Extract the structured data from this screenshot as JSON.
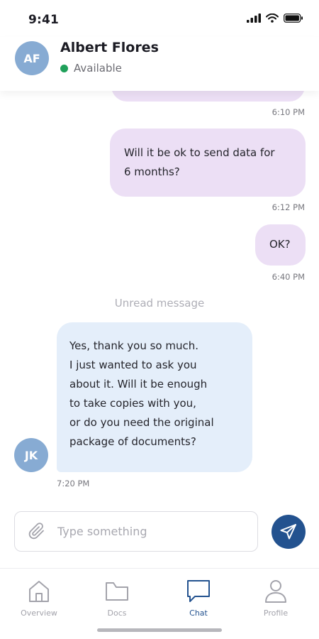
{
  "status_bar": {
    "time": "9:41"
  },
  "header": {
    "avatar_initials": "AF",
    "contact_name": "Albert Flores",
    "presence": "Available"
  },
  "messages": [
    {
      "direction": "out",
      "lines": [],
      "time": "6:10 PM"
    },
    {
      "direction": "out",
      "lines": [
        "Will it be ok to send data for",
        "6 months?"
      ],
      "time": "6:12 PM"
    },
    {
      "direction": "out",
      "lines": [
        "OK?"
      ],
      "time": "6:40 PM"
    },
    {
      "direction": "in",
      "sender_initials": "JK",
      "lines": [
        "Yes, thank you so much.",
        "I just wanted to ask you",
        "about it. Will it be enough",
        "to take copies with you,",
        "or do you need the original",
        "package of documents?"
      ],
      "time": "7:20 PM"
    }
  ],
  "unread_divider": "Unread message",
  "composer": {
    "placeholder": "Type something",
    "value": ""
  },
  "tabs": [
    {
      "label": "Overview",
      "icon": "home-icon",
      "active": false
    },
    {
      "label": "Docs",
      "icon": "folder-icon",
      "active": false
    },
    {
      "label": "Chat",
      "icon": "chat-bubble-icon",
      "active": true
    },
    {
      "label": "Profile",
      "icon": "person-icon",
      "active": false
    }
  ],
  "colors": {
    "accent": "#23528f",
    "outgoing_bubble": "#ecdff5",
    "incoming_bubble": "#e4eefa",
    "avatar": "#87abd3",
    "presence": "#1fa05a"
  }
}
